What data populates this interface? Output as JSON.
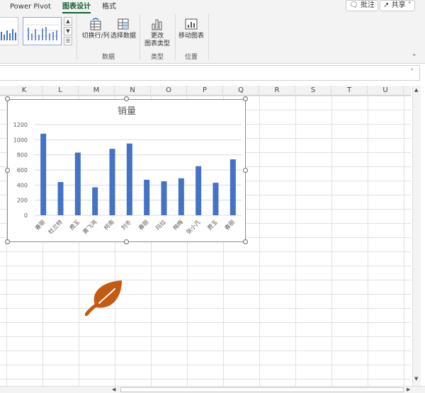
{
  "ribbon": {
    "tabs": [
      {
        "label": "Power Pivot"
      },
      {
        "label": "图表设计"
      },
      {
        "label": "格式"
      }
    ],
    "comments_label": "批注",
    "share_label": "共享",
    "buttons": {
      "switch_row_col": "切换行/列",
      "select_data": "选择数据",
      "change_type_line1": "更改",
      "change_type_line2": "图表类型",
      "move_chart": "移动图表"
    },
    "groups": {
      "data": "数据",
      "type": "类型",
      "location": "位置"
    }
  },
  "columns": [
    "K",
    "L",
    "M",
    "N",
    "O",
    "P",
    "Q",
    "R",
    "S",
    "T",
    "U"
  ],
  "colors": {
    "bar": "#4472c4",
    "leaf": "#c55a11",
    "tab_active": "#185c37"
  },
  "leaf_icon": "leaf-icon",
  "chart_data": {
    "type": "bar",
    "title": "销量",
    "categories": [
      "春丽",
      "杜兰特",
      "费玉",
      "黄飞鸿",
      "柯南",
      "刘冬",
      "春丽",
      "玛拉",
      "梅梅",
      "张小凡",
      "费玉",
      "春丽"
    ],
    "values": [
      1080,
      440,
      830,
      370,
      880,
      950,
      470,
      450,
      490,
      650,
      430,
      740
    ],
    "ylim": [
      0,
      1200
    ],
    "yticks": [
      0,
      200,
      400,
      600,
      800,
      1000,
      1200
    ],
    "grid": true,
    "xlabel": "",
    "ylabel": ""
  }
}
